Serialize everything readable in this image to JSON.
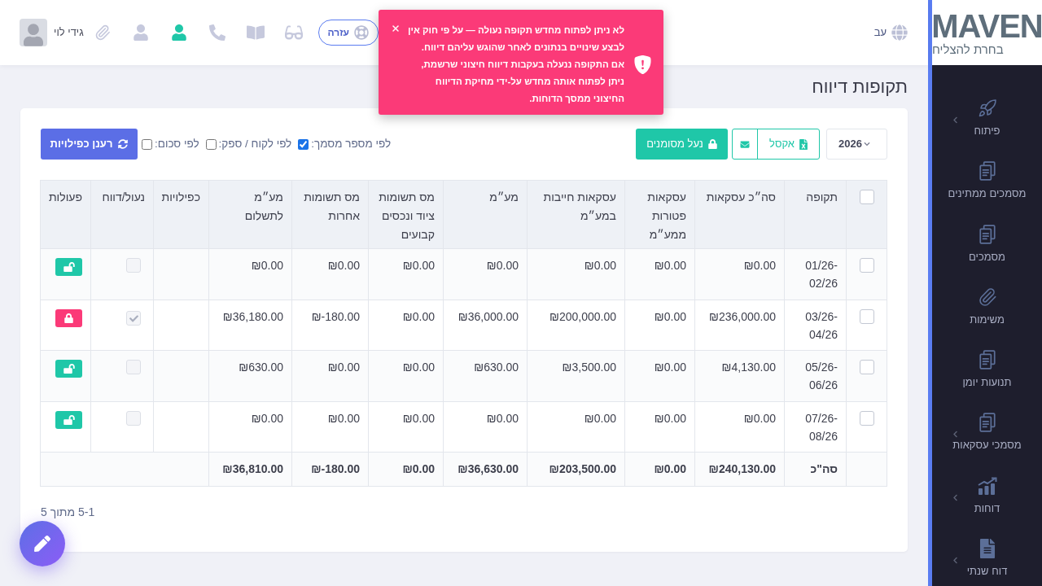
{
  "sidebar": {
    "logo": {
      "wordmark": "MAVEN",
      "tagline": "בחרת להצליח"
    },
    "items": [
      {
        "label": "פיתוח",
        "has_submenu": true
      },
      {
        "label": "מסמכים ממתינים",
        "has_submenu": false
      },
      {
        "label": "מסמכים",
        "has_submenu": false
      },
      {
        "label": "משימות",
        "has_submenu": false
      },
      {
        "label": "תנועות יומן",
        "has_submenu": false
      },
      {
        "label": "מסמכי עסקאות",
        "has_submenu": true
      },
      {
        "label": "דוחות",
        "has_submenu": true
      },
      {
        "label": "דוח שנתי",
        "has_submenu": true
      }
    ]
  },
  "header": {
    "language": "עב",
    "help_button": "עזרה",
    "nav_icons": [
      {
        "selected": false
      },
      {
        "selected": false
      },
      {
        "selected": false
      },
      {
        "selected": true
      },
      {
        "selected": false
      },
      {
        "selected": false
      }
    ],
    "user_name": "גידי לוי"
  },
  "toast": {
    "message": "לא ניתן לפתוח מחדש תקופה נעולה — על פי חוק אין לבצע שינויים בנתונים לאחר שהוגש עליהם דיווח. אם התקופה ננעלה בעקבות דיווח חיצוני שרשמת, ניתן לפתוח אותה מחדש על-ידי מחיקת הדיווח החיצוני ממסך הדוחות."
  },
  "page_title": "תקופות דיווח",
  "toolbar": {
    "year_select": "2026",
    "excel_button": "אקסל",
    "lock_selected_button": "נעל מסומנים",
    "duplicate_filters": [
      {
        "label": "לפי מספר מסמך:",
        "checked": true
      },
      {
        "label": "לפי לקוח / ספק:",
        "checked": false
      },
      {
        "label": "לפי סכום:",
        "checked": false
      }
    ],
    "refresh_duplicates_button": "רענן כפילויות"
  },
  "table": {
    "select_all": {
      "checked": false
    },
    "columns": [
      "תקופה",
      "סה״כ עסקאות",
      "עסקאות פטורות ממע״מ",
      "עסקאות חייבות במע״מ",
      "מע״מ",
      "מס תשומות ציוד ונכסים קבועים",
      "מס תשומות אחרות",
      "מע״מ לתשלום",
      "כפילויות",
      "נעול/דווח",
      "פעולות"
    ],
    "rows": [
      {
        "selected": false,
        "period": "01/26-02/26",
        "amounts": [
          "₪0.00",
          "₪0.00",
          "₪0.00",
          "₪0.00",
          "₪0.00",
          "₪0.00",
          "₪0.00"
        ],
        "reported": false,
        "locked": false
      },
      {
        "selected": false,
        "period": "03/26-04/26",
        "amounts": [
          "₪236,000.00",
          "₪0.00",
          "₪200,000.00",
          "₪36,000.00",
          "₪0.00",
          "₪-180.00",
          "₪36,180.00"
        ],
        "reported": true,
        "locked": true
      },
      {
        "selected": false,
        "period": "05/26-06/26",
        "amounts": [
          "₪4,130.00",
          "₪0.00",
          "₪3,500.00",
          "₪630.00",
          "₪0.00",
          "₪0.00",
          "₪630.00"
        ],
        "reported": false,
        "locked": false
      },
      {
        "selected": false,
        "period": "07/26-08/26",
        "amounts": [
          "₪0.00",
          "₪0.00",
          "₪0.00",
          "₪0.00",
          "₪0.00",
          "₪0.00",
          "₪0.00"
        ],
        "reported": false,
        "locked": false
      }
    ],
    "totals": {
      "label": "סה\"כ",
      "amounts": [
        "₪240,130.00",
        "₪0.00",
        "₪203,500.00",
        "₪36,630.00",
        "₪0.00",
        "₪-180.00",
        "₪36,810.00"
      ]
    }
  },
  "pagination": "1‐5 מתוך 5"
}
